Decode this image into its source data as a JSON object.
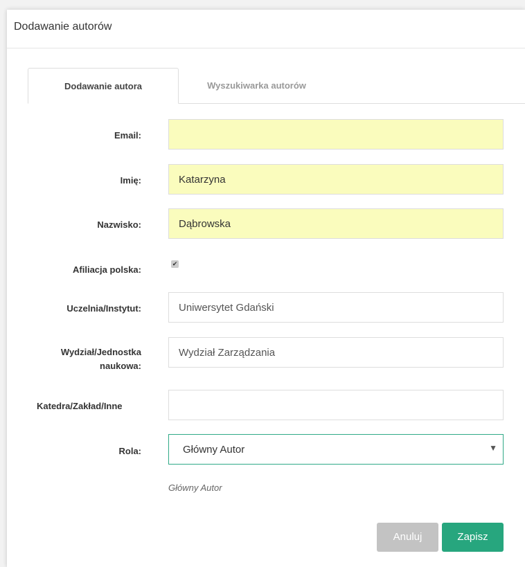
{
  "modal": {
    "title": "Dodawanie autorów"
  },
  "tabs": [
    {
      "label": "Dodawanie autora",
      "active": true
    },
    {
      "label": "Wyszukiwarka autorów",
      "active": false
    }
  ],
  "form": {
    "email": {
      "label": "Email:",
      "value": ""
    },
    "first_name": {
      "label": "Imię:",
      "value": "Katarzyna"
    },
    "last_name": {
      "label": "Nazwisko:",
      "value": "Dąbrowska"
    },
    "polish_affiliation": {
      "label": "Afiliacja polska:",
      "checked": true
    },
    "university": {
      "label": "Uczelnia/Instytut:",
      "value": "Uniwersytet Gdański"
    },
    "faculty": {
      "label_line1": "Wydział/Jednostka",
      "label_line2": "naukowa:",
      "value": "Wydział Zarządzania"
    },
    "department": {
      "label": "Katedra/Zakład/Inne",
      "value": ""
    },
    "role": {
      "label": "Rola:",
      "selected": "Główny Autor",
      "help": "Główny Autor"
    }
  },
  "buttons": {
    "cancel": "Anuluj",
    "save": "Zapisz"
  },
  "colors": {
    "autofill": "#fafcbd",
    "accent": "#27a67e",
    "cancel": "#c3c3c3"
  }
}
